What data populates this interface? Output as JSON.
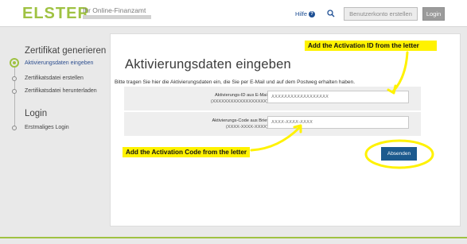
{
  "header": {
    "logo": "ELSTER",
    "tagline": "Ihr Online-Finanzamt",
    "help_label": "Hilfe",
    "help_badge": "?",
    "register_label": "Benutzerkonto erstellen",
    "login_label": "Login"
  },
  "sidebar": {
    "section1_title": "Zertifikat generieren",
    "section1_items": [
      "Aktivierungsdaten eingeben",
      "Zertifikatsdatei erstellen",
      "Zertifikatsdatei herunterladen"
    ],
    "section2_title": "Login",
    "section2_items": [
      "Erstmaliges Login"
    ]
  },
  "main": {
    "title": "Aktivierungsdaten eingeben",
    "description": "Bitte tragen Sie hier die Aktivierungsdaten ein, die Sie per E-Mail und auf dem Postweg erhalten haben.",
    "fields": [
      {
        "label": "Aktivierungs-ID aus E-Mail",
        "hint": "(XXXXXXXXXXXXXXXXXX)",
        "placeholder": "XXXXXXXXXXXXXXXXXX"
      },
      {
        "label": "Aktivierungs-Code aus Brief",
        "hint": "(XXXX-XXXX-XXXX)",
        "placeholder": "XXXX-XXXX-XXXX"
      }
    ],
    "submit_label": "Absenden"
  },
  "annotations": {
    "callout_activation_id": "Add the Activation ID from the letter",
    "callout_activation_code": "Add the Activation Code from the letter",
    "highlight_color": "#fff200"
  },
  "colors": {
    "brand_green": "#9fc242",
    "primary_blue": "#1c5a8e",
    "link_blue": "#1e4f94"
  },
  "icons": {
    "help": "question-circle-icon",
    "search": "search-icon"
  }
}
